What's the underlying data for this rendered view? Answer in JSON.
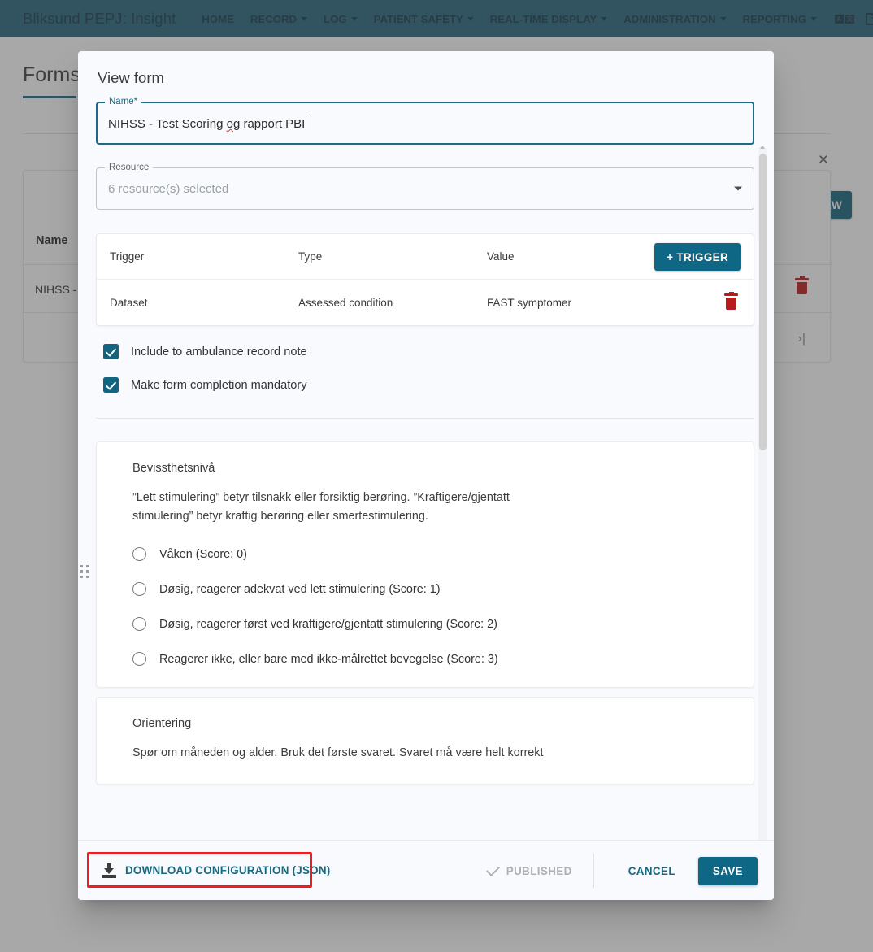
{
  "navbar": {
    "brand": "Bliksund PEPJ: Insight",
    "items": [
      {
        "label": "HOME",
        "caret": false
      },
      {
        "label": "RECORD",
        "caret": true
      },
      {
        "label": "LOG",
        "caret": true
      },
      {
        "label": "PATIENT SAFETY",
        "caret": true
      },
      {
        "label": "REAL-TIME DISPLAY",
        "caret": true
      },
      {
        "label": "ADMINISTRATION",
        "caret": true
      },
      {
        "label": "REPORTING",
        "caret": true
      }
    ],
    "lang_icon_a": "A",
    "lang_icon_b": "文",
    "accent": "#26647a"
  },
  "background": {
    "page_title": "Forms",
    "close_label": "×",
    "new_button": "NEW",
    "table_header_name": "Name",
    "table_row_name": "NIHSS - T",
    "pager_last": "›|"
  },
  "dialog": {
    "title": "View form",
    "name_field": {
      "legend": "Name*",
      "value_pre": "NIHSS - Test Scoring ",
      "value_spell": "og",
      "value_post": " rapport PBI"
    },
    "resource_field": {
      "legend": "Resource",
      "value": "6 resource(s) selected"
    },
    "trigger_table": {
      "columns": [
        "Trigger",
        "Type",
        "Value"
      ],
      "add_button": "+  TRIGGER",
      "rows": [
        {
          "trigger": "Dataset",
          "type": "Assessed condition",
          "value": "FAST symptomer"
        }
      ]
    },
    "checkboxes": [
      {
        "label": "Include to ambulance record note",
        "checked": true
      },
      {
        "label": "Make form completion mandatory",
        "checked": true
      }
    ],
    "questions": [
      {
        "title": "Bevissthetsnivå",
        "description": "”Lett stimulering” betyr tilsnakk eller forsiktig berøring. ”Kraftigere/gjentatt stimulering” betyr kraftig berøring eller smertestimulering.",
        "options": [
          "Våken (Score: 0)",
          "Døsig, reagerer adekvat ved lett stimulering (Score: 1)",
          "Døsig, reagerer først ved kraftigere/gjentatt stimulering (Score: 2)",
          "Reagerer ikke, eller bare med ikke-målrettet bevegelse (Score: 3)"
        ]
      },
      {
        "title": "Orientering",
        "description": "Spør om måneden og alder. Bruk det første svaret. Svaret må være helt korrekt",
        "options": []
      }
    ],
    "footer": {
      "download_label": "DOWNLOAD CONFIGURATION (JSON)",
      "published_label": "PUBLISHED",
      "cancel_label": "CANCEL",
      "save_label": "SAVE",
      "highlight_color": "#ee1d24",
      "accent_color": "#0f6786"
    }
  }
}
